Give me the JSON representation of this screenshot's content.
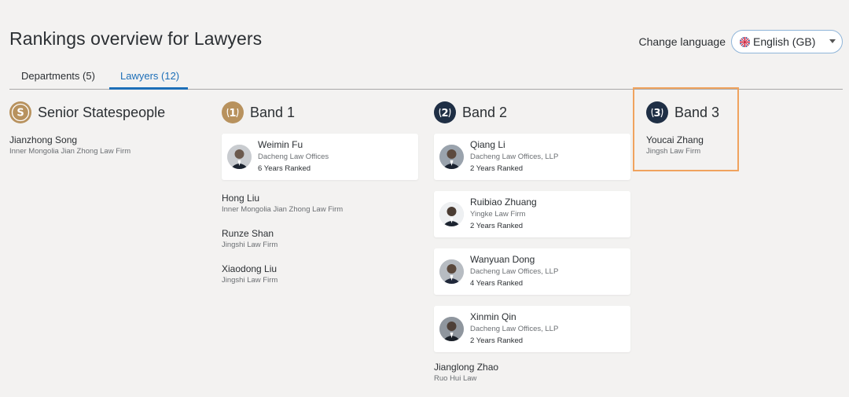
{
  "header": {
    "title": "Rankings overview for Lawyers",
    "change_language_label": "Change language",
    "language_value": "English (GB)"
  },
  "tabs": [
    {
      "label": "Departments (5)",
      "active": false
    },
    {
      "label": "Lawyers (12)",
      "active": true
    }
  ],
  "colors": {
    "accent": "#1d6fb8",
    "senior_badge": "#b8925e",
    "band1_badge": "#b8925e",
    "dark_badge": "#1f2f45",
    "highlight": "#f0a35e"
  },
  "columns": [
    {
      "badge": "S",
      "title": "Senior Statespeople",
      "cards": [],
      "plain": [
        {
          "name": "Jianzhong Song",
          "firm": "Inner Mongolia Jian Zhong Law Firm"
        }
      ]
    },
    {
      "badge": "1",
      "title": "Band 1",
      "cards": [
        {
          "name": "Weimin Fu",
          "firm": "Dacheng Law Offices",
          "years": "6 Years Ranked"
        }
      ],
      "plain": [
        {
          "name": "Hong Liu",
          "firm": "Inner Mongolia Jian Zhong Law Firm"
        },
        {
          "name": "Runze Shan",
          "firm": "Jingshi Law Firm"
        },
        {
          "name": "Xiaodong Liu",
          "firm": "Jingshi Law Firm"
        }
      ]
    },
    {
      "badge": "2",
      "title": "Band 2",
      "cards": [
        {
          "name": "Qiang Li",
          "firm": "Dacheng Law Offices, LLP",
          "years": "2 Years Ranked"
        },
        {
          "name": "Ruibiao Zhuang",
          "firm": "Yingke Law Firm",
          "years": "2 Years Ranked"
        },
        {
          "name": "Wanyuan Dong",
          "firm": "Dacheng Law Offices, LLP",
          "years": "4 Years Ranked"
        },
        {
          "name": "Xinmin Qin",
          "firm": "Dacheng Law Offices, LLP",
          "years": "2 Years Ranked"
        }
      ],
      "plain": [
        {
          "name": "Jianglong Zhao",
          "firm": "Ruo Hui Law"
        }
      ]
    },
    {
      "badge": "3",
      "title": "Band 3",
      "cards": [],
      "plain": [
        {
          "name": "Youcai Zhang",
          "firm": "Jingsh Law Firm"
        }
      ]
    }
  ]
}
